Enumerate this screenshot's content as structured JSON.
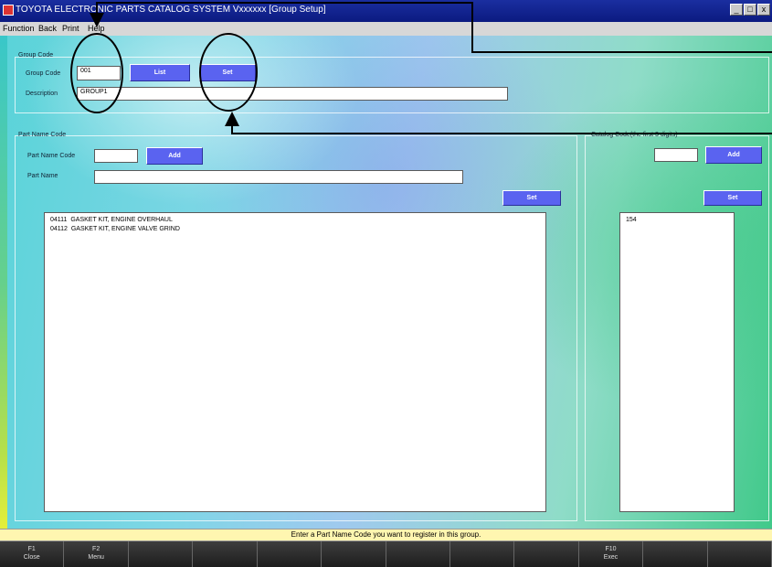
{
  "window": {
    "title": "TOYOTA ELECTRONIC PARTS CATALOG SYSTEM Vxxxxxx [Group Setup]",
    "controls": [
      "_",
      "□",
      "x"
    ]
  },
  "menu": [
    "Function",
    "Back",
    "Print",
    "Help"
  ],
  "group_code": {
    "section_label": "Group Code",
    "code_label": "Group Code",
    "code_value": "001",
    "list_button": "List",
    "set_button": "Set",
    "description_label": "Description",
    "description_value": "GROUP1"
  },
  "part_name": {
    "section_label": "Part Name Code",
    "code_label": "Part Name Code",
    "code_value": "",
    "add_button": "Add",
    "name_label": "Part Name",
    "name_value": "",
    "set_button": "Set",
    "items": [
      {
        "code": "04111",
        "name": "GASKET KIT, ENGINE OVERHAUL"
      },
      {
        "code": "04112",
        "name": "GASKET KIT, ENGINE VALVE GRIND"
      }
    ]
  },
  "catalog_code": {
    "section_label": "Catalog Code(the first 3 digits)",
    "value": "",
    "add_button": "Add",
    "set_button": "Set",
    "items": [
      "154"
    ]
  },
  "status": "Enter a Part Name Code you want to register in this group.",
  "fkeys": [
    {
      "key": "F1",
      "label": "Close"
    },
    {
      "key": "F2",
      "label": "Menu"
    },
    {
      "key": "",
      "label": ""
    },
    {
      "key": "",
      "label": ""
    },
    {
      "key": "",
      "label": ""
    },
    {
      "key": "",
      "label": ""
    },
    {
      "key": "",
      "label": ""
    },
    {
      "key": "",
      "label": ""
    },
    {
      "key": "",
      "label": ""
    },
    {
      "key": "F10",
      "label": "Exec"
    },
    {
      "key": "",
      "label": ""
    },
    {
      "key": "",
      "label": ""
    }
  ]
}
